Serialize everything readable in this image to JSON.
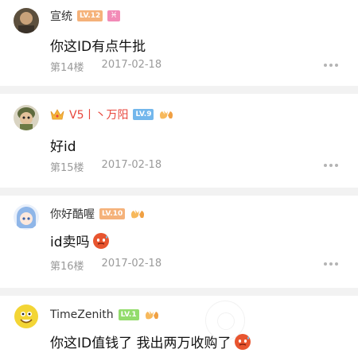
{
  "comments": [
    {
      "username": "宣统",
      "level": "LV.12",
      "zodiac": "♓",
      "content": "你这ID有点牛批",
      "floor": "第14楼",
      "date": "2017-02-18",
      "avatar_icon": "avatar-man-photo"
    },
    {
      "username": "V5丨丶万阳",
      "level": "LV.9",
      "badge_icon": "crown-icon",
      "content": "好id",
      "floor": "第15楼",
      "date": "2017-02-18",
      "avatar_icon": "avatar-soldier-photo"
    },
    {
      "username": "你好酷喔",
      "level": "LV.10",
      "content": "id卖吗",
      "content_emoji": "sweat-emoji",
      "floor": "第16楼",
      "date": "2017-02-18",
      "avatar_icon": "avatar-anime-girl"
    },
    {
      "username": "TimeZenith",
      "level": "LV.1",
      "content": "你这ID值钱了 我出两万收购了",
      "content_emoji": "sweat-emoji",
      "avatar_icon": "avatar-yellow-cartoon"
    }
  ],
  "colors": {
    "vip_name": "#e8463c",
    "level_orange": "#f5b27a",
    "level_blue": "#73b7ec",
    "level_green": "#93dc6c",
    "meta_text": "#9a9a9a",
    "divider": "#f2f2f2"
  }
}
